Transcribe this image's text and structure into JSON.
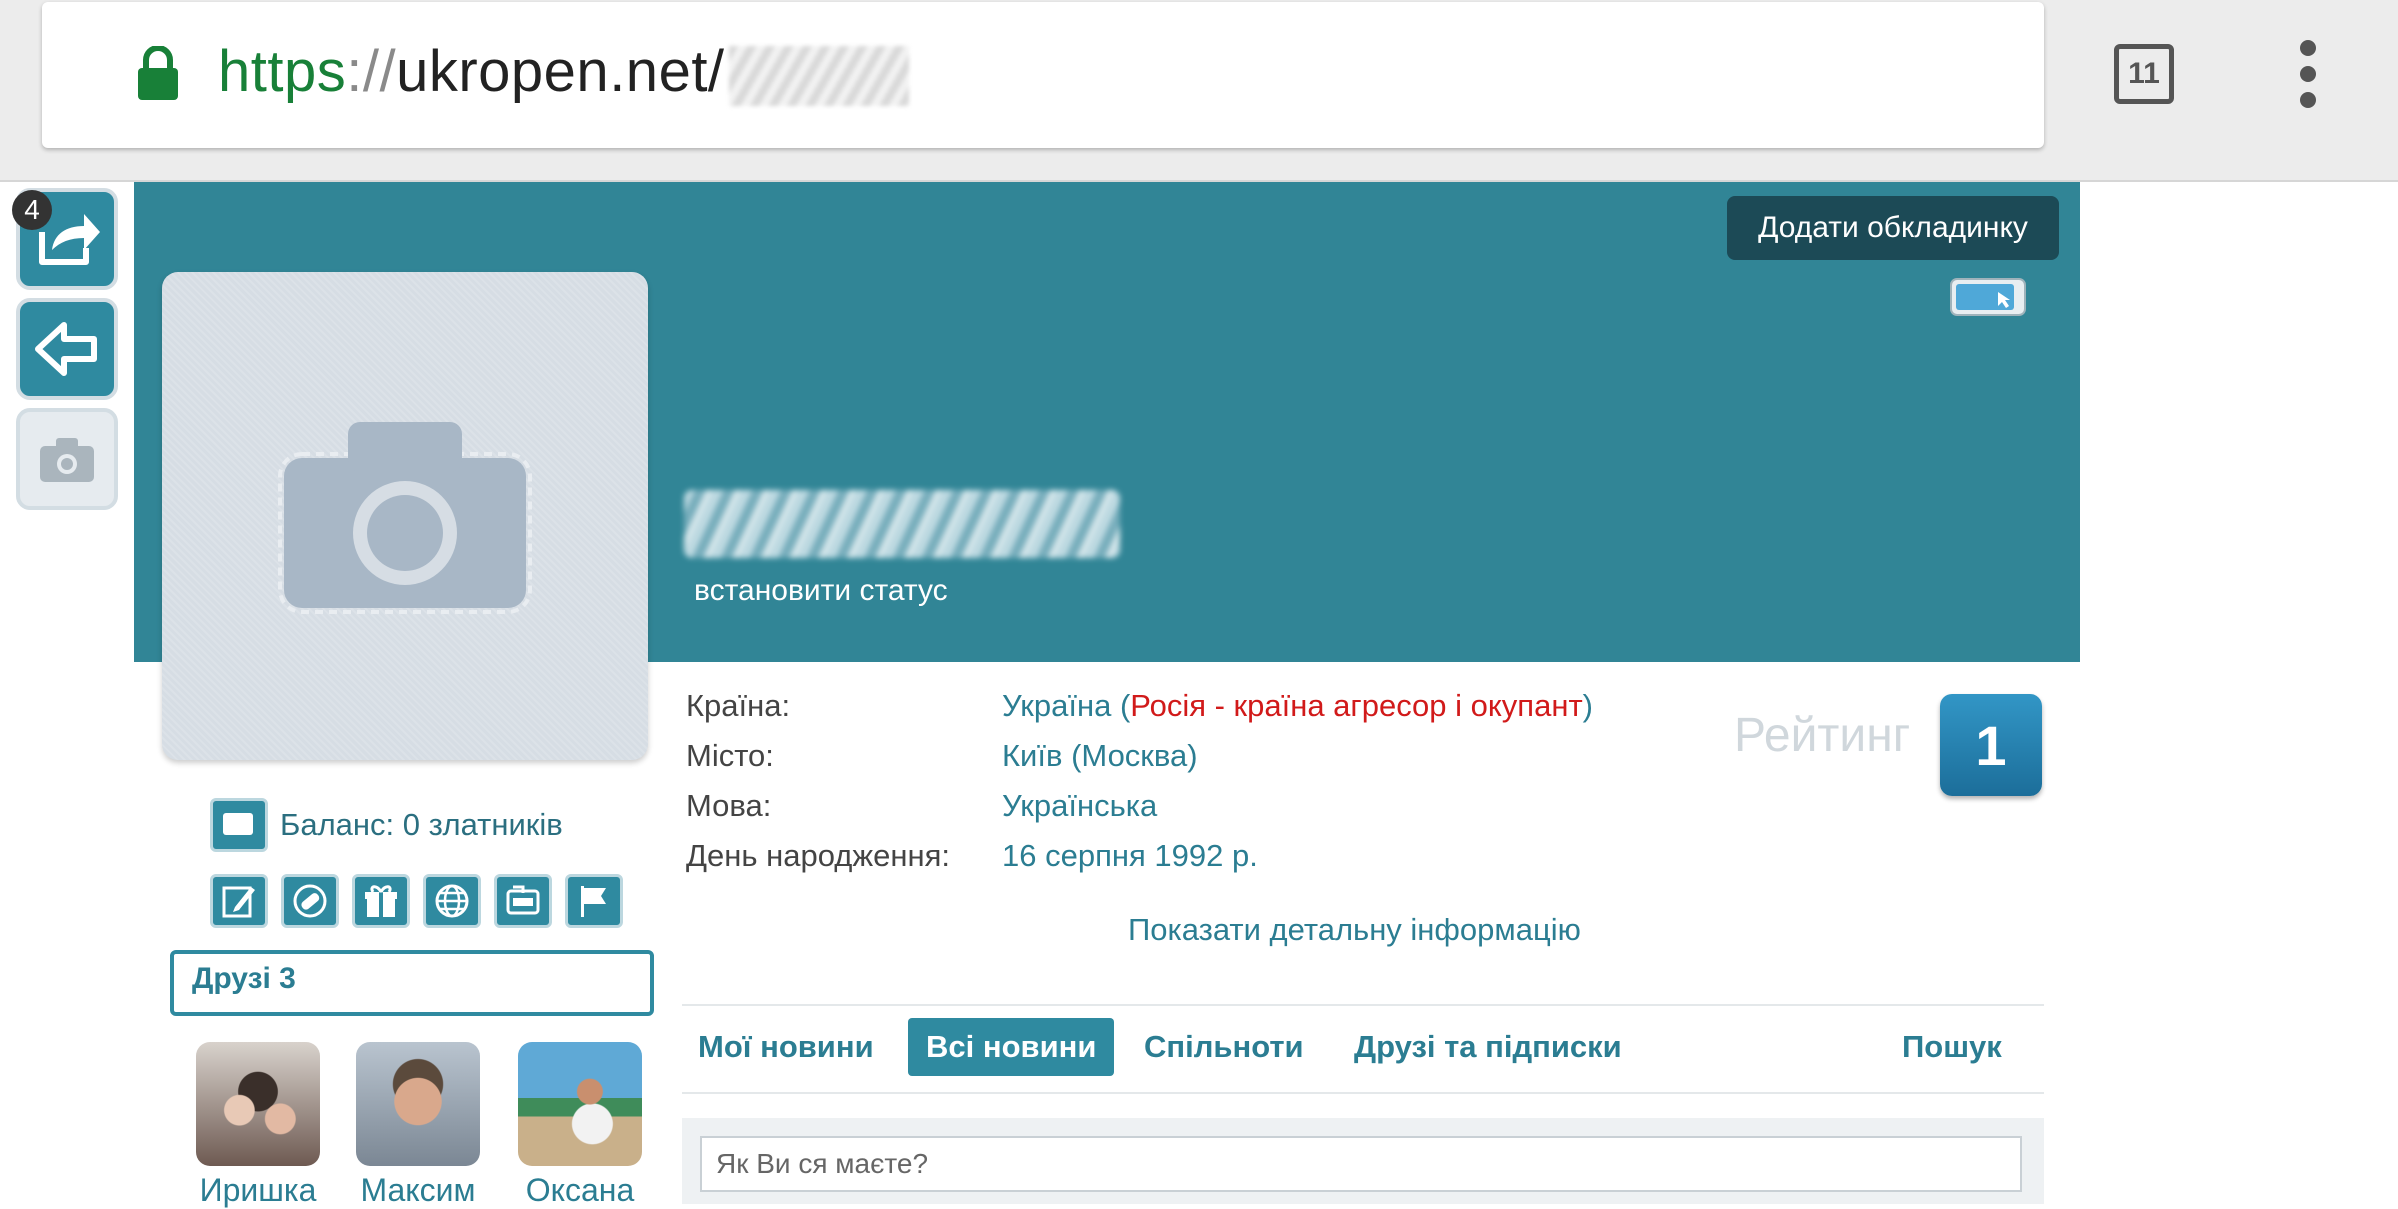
{
  "browser": {
    "url_scheme": "https",
    "url_separator": "://",
    "url_host": "ukropen.net/",
    "tab_count": "11"
  },
  "sidebar_tools": {
    "notifications_count": "4"
  },
  "cover": {
    "add_cover_label": "Додати обкладинку",
    "set_status_label": "встановити статус"
  },
  "profile": {
    "balance_label": "Баланс: 0 златників",
    "friends_title": "Друзі 3",
    "friends": [
      {
        "name": "Иришка"
      },
      {
        "name": "Максим"
      },
      {
        "name": "Оксана"
      }
    ]
  },
  "info": {
    "country_label": "Країна:",
    "country_value": "Україна",
    "country_paren_open": " (",
    "country_note": "Росія - країна агресор і окупант",
    "country_paren_close": ")",
    "city_label": "Місто:",
    "city_value": "Київ (Москва)",
    "language_label": "Мова:",
    "language_value": "Українська",
    "birthday_label": "День народження:",
    "birthday_value": "16 серпня 1992 р.",
    "show_more_label": "Показати детальну інформацію"
  },
  "rating": {
    "label": "Рейтинг",
    "value": "1"
  },
  "tabs": [
    {
      "label": "Мої новини"
    },
    {
      "label": "Всі новини"
    },
    {
      "label": "Спільноти"
    },
    {
      "label": "Друзі та підписки"
    },
    {
      "label": "Пошук"
    }
  ],
  "composer": {
    "placeholder": "Як Ви ся маєте?"
  },
  "colors": {
    "accent": "#2f8aa0",
    "cover": "#318596",
    "link": "#2b7d92",
    "warning_red": "#d11a1a"
  }
}
